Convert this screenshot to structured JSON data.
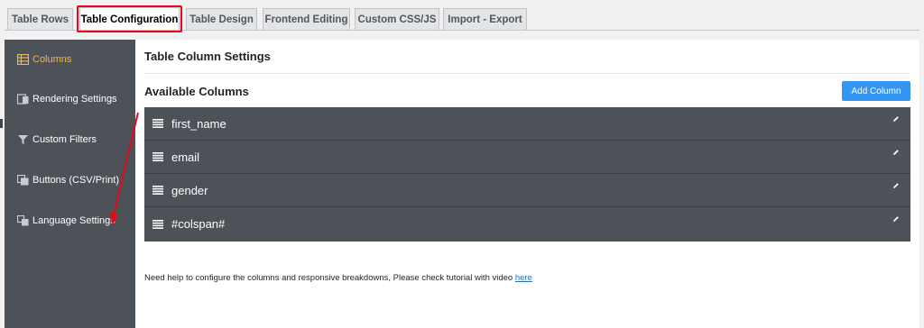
{
  "tabs": [
    {
      "label": "Table Rows"
    },
    {
      "label": "Table Configuration",
      "active": true
    },
    {
      "label": "Table Design"
    },
    {
      "label": "Frontend Editing"
    },
    {
      "label": "Custom CSS/JS"
    },
    {
      "label": "Import - Export"
    }
  ],
  "sidebar": {
    "items": [
      {
        "label": "Columns",
        "icon": "table-icon",
        "active": true
      },
      {
        "label": "Rendering Settings",
        "icon": "rendering-icon"
      },
      {
        "label": "Custom Filters",
        "icon": "filter-icon"
      },
      {
        "label": "Buttons (CSV/Print)",
        "icon": "copy-icon"
      },
      {
        "label": "Language Settings",
        "icon": "translate-icon"
      }
    ]
  },
  "main": {
    "title": "Table Column Settings",
    "available_title": "Available Columns",
    "add_button": "Add Column",
    "columns": [
      {
        "name": "first_name"
      },
      {
        "name": "email"
      },
      {
        "name": "gender"
      },
      {
        "name": "#colspan#"
      }
    ],
    "help_text": "Need help to configure the columns and responsive breakdowns, Please check tutorial with video",
    "help_link": "here"
  },
  "colors": {
    "sidebar_bg": "#4d5258",
    "active_accent": "#f0b849",
    "button_blue": "#3496f2",
    "highlight_red": "#e3091c"
  }
}
